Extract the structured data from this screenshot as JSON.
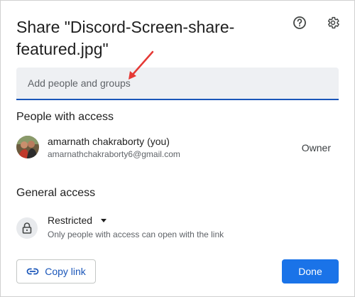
{
  "dialog": {
    "title": "Share \"Discord-Screen-share-featured.jpg\""
  },
  "toolbar": {
    "help_icon": "help-circle-icon",
    "settings_icon": "gear-icon"
  },
  "add_people": {
    "placeholder": "Add people and groups"
  },
  "people_with_access": {
    "heading": "People with access",
    "user": {
      "name": "amarnath chakraborty (you)",
      "email": "amarnathchakraborty6@gmail.com",
      "role": "Owner"
    }
  },
  "general_access": {
    "heading": "General access",
    "value": "Restricted",
    "description": "Only people with access can open with the link",
    "icon": "lock-icon"
  },
  "footer": {
    "copy_link_label": "Copy link",
    "copy_link_icon": "link-icon",
    "done_label": "Done"
  },
  "colors": {
    "accent": "#1a73e8",
    "link_text": "#1a56b9",
    "annotation_arrow": "#e53935"
  }
}
